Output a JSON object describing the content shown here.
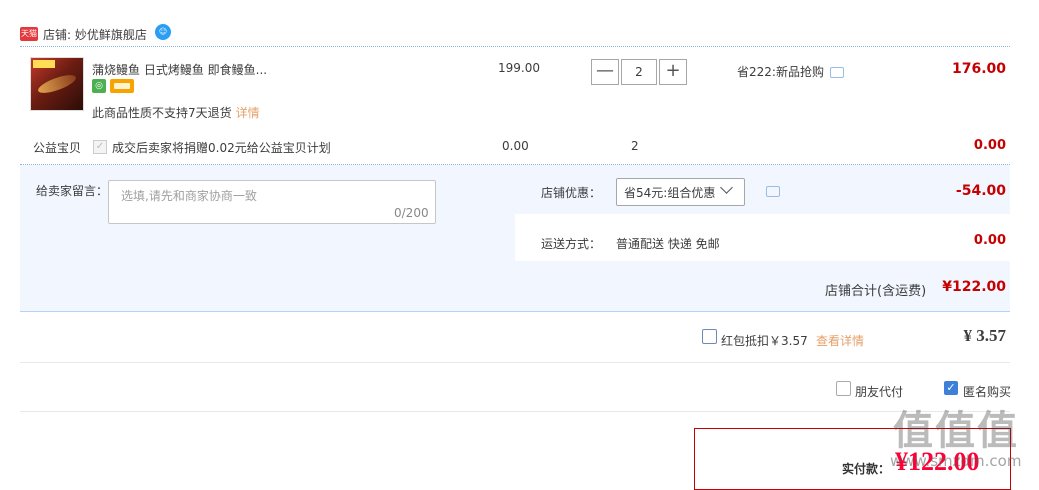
{
  "store": {
    "badge": "天猫",
    "name": "店铺: 妙优鲜旗舰店"
  },
  "item": {
    "title": "蒲烧鳗鱼 日式烤鳗鱼 即食鳗鱼...",
    "no_return": "此商品性质不支持7天退货",
    "detail_link": "详情",
    "unit_price": "199.00",
    "qty_minus": "—",
    "qty": "2",
    "qty_plus": "+",
    "promo": "省222:新品抢购",
    "total": "176.00"
  },
  "charity": {
    "label": "公益宝贝",
    "check": "✓",
    "text": "成交后卖家将捐赠0.02元给公益宝贝计划",
    "price": "0.00",
    "qty": "2",
    "total": "0.00"
  },
  "message": {
    "label": "给卖家留言：",
    "placeholder": "选填,请先和商家协商一致",
    "count": "0/200"
  },
  "shop_promo": {
    "label": "店铺优惠：",
    "value": "省54元:组合优惠",
    "amount": "-54.00"
  },
  "shipping": {
    "label": "运送方式：",
    "value": "普通配送 快递 免邮",
    "amount": "0.00"
  },
  "subtotal": {
    "label": "店铺合计(含运费)",
    "value": "¥122.00"
  },
  "red_packet": {
    "label": "红包抵扣￥3.57",
    "link": "查看详情",
    "amount": "¥ 3.57"
  },
  "options": {
    "friend_pay": "朋友代付",
    "anonymous": "匿名购买",
    "anon_check": "✓"
  },
  "final": {
    "label": "实付款：",
    "amount": "¥122.00"
  },
  "watermark": {
    "logo": "值值值",
    "url": "www.smzdm.com"
  },
  "colors": {
    "price_red": "#ff0036",
    "accent_blue": "#3e80d8",
    "border_red": "#c40000"
  }
}
